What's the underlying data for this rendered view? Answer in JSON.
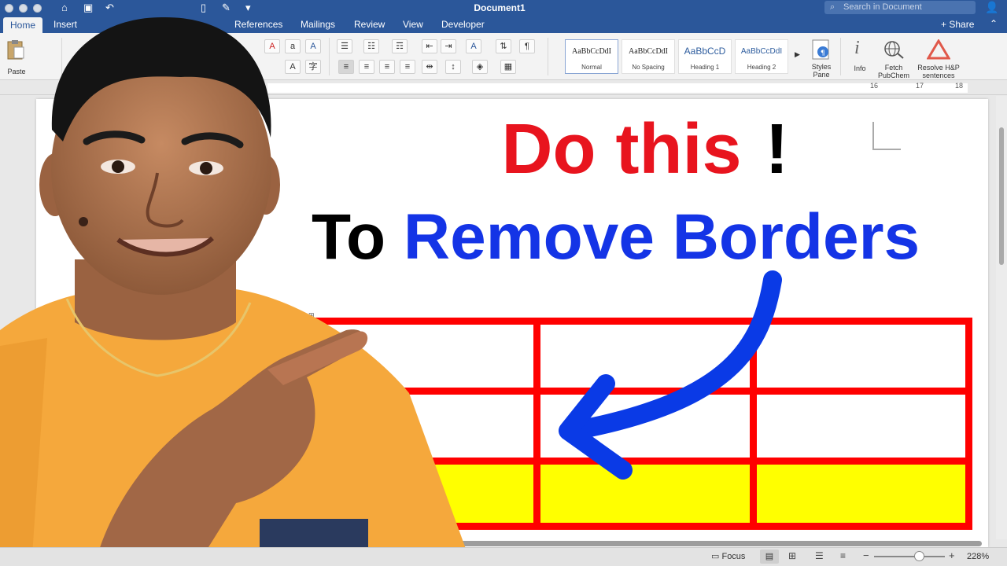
{
  "window": {
    "title": "Document1"
  },
  "search": {
    "placeholder": "Search in Document"
  },
  "tabs": [
    {
      "label": "Home"
    },
    {
      "label": "Insert"
    },
    {
      "label": "References"
    },
    {
      "label": "Mailings"
    },
    {
      "label": "Review"
    },
    {
      "label": "View"
    },
    {
      "label": "Developer"
    }
  ],
  "share_label": "Share",
  "ribbon": {
    "paste_label": "Paste",
    "styles": [
      {
        "preview": "AaBbCcDdI",
        "name": "Normal"
      },
      {
        "preview": "AaBbCcDdI",
        "name": "No Spacing"
      },
      {
        "preview": "AaBbCcD",
        "name": "Heading 1"
      },
      {
        "preview": "AaBbCcDdI",
        "name": "Heading 2"
      }
    ],
    "styles_pane_label": "Styles Pane",
    "info_label": "Info",
    "fetch_label": "Fetch PubChem",
    "resolve_label": "Resolve H&P sentences"
  },
  "ruler_numbers": [
    "16",
    "17",
    "18"
  ],
  "document": {
    "line1_main": "Do this",
    "line1_bang": "!",
    "line2_black": "To",
    "line2_blue": "Remove Borders"
  },
  "table": {
    "rows": 3,
    "cols": 3,
    "border_color": "#ff0000",
    "highlight_row_color": "#ffff00"
  },
  "status": {
    "focus_label": "Focus",
    "zoom": "228%"
  },
  "colors": {
    "brand": "#2b579a",
    "headline_red": "#e8141e",
    "headline_blue": "#1434e6",
    "arrow_blue": "#0a3ae6"
  }
}
